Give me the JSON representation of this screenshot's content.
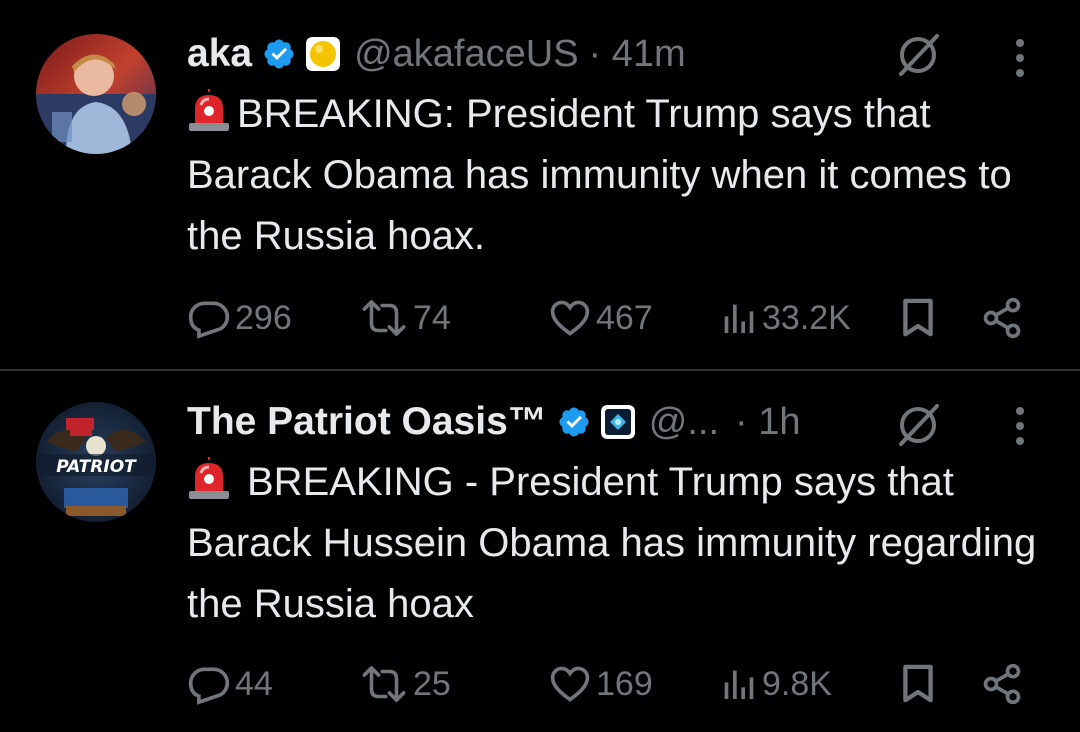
{
  "tweets": [
    {
      "author_name": "aka",
      "handle": "@akafaceUS",
      "time": "· 41m",
      "text": "BREAKING: President Trump says that Barack Obama has immunity when it comes to the Russia hoax.",
      "replies": "296",
      "reposts": "74",
      "likes": "467",
      "views": "33.2K",
      "affiliation_badge": "yellow-circle-badge-icon"
    },
    {
      "author_name": "The Patriot Oasis™",
      "handle": "@...",
      "time": "· 1h",
      "text": "BREAKING - President Trump says that Barack Hussein Obama has immunity regarding the Russia hoax",
      "replies": "44",
      "reposts": "25",
      "likes": "169",
      "views": "9.8K",
      "avatar_text": "PATRIOT",
      "affiliation_badge": "blue-diamond-badge-icon"
    }
  ],
  "icons": {
    "verified": "verified-badge-icon",
    "siren": "rotating-light-emoji-icon",
    "grok": "grok-icon",
    "more": "more-vertical-icon",
    "reply": "reply-icon",
    "repost": "repost-icon",
    "like": "heart-icon",
    "views": "views-icon",
    "bookmark": "bookmark-icon",
    "share": "share-icon"
  },
  "colors": {
    "background": "#000000",
    "text": "#e7e9ea",
    "secondary": "#71767b",
    "verified_blue": "#1d9bf0",
    "divider": "#2f3336"
  }
}
